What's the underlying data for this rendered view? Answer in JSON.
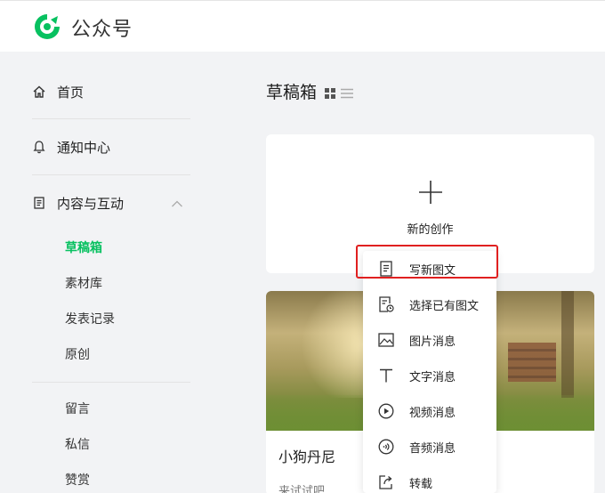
{
  "app": {
    "title": "公众号",
    "brand_color": "#07c160"
  },
  "sidebar": {
    "items": [
      {
        "label": "首页",
        "icon": "home-icon"
      },
      {
        "label": "通知中心",
        "icon": "bell-icon"
      },
      {
        "label": "内容与互动",
        "icon": "document-icon",
        "expanded": true
      }
    ],
    "sub_items": [
      {
        "label": "草稿箱",
        "active": true
      },
      {
        "label": "素材库"
      },
      {
        "label": "发表记录"
      },
      {
        "label": "原创"
      },
      {
        "label": "留言"
      },
      {
        "label": "私信"
      },
      {
        "label": "赞赏"
      }
    ]
  },
  "main": {
    "title": "草稿箱",
    "create_label": "新的创作",
    "article": {
      "title": "小狗丹尼",
      "desc": "来试试吧"
    }
  },
  "dropdown": {
    "items": [
      {
        "label": "写新图文",
        "icon": "new-article-icon",
        "highlighted": true
      },
      {
        "label": "选择已有图文",
        "icon": "existing-article-icon"
      },
      {
        "label": "图片消息",
        "icon": "image-icon"
      },
      {
        "label": "文字消息",
        "icon": "text-icon"
      },
      {
        "label": "视频消息",
        "icon": "video-icon"
      },
      {
        "label": "音频消息",
        "icon": "audio-icon"
      },
      {
        "label": "转载",
        "icon": "repost-icon"
      }
    ]
  },
  "colors": {
    "highlight": "#e02020",
    "active": "#07c160"
  }
}
